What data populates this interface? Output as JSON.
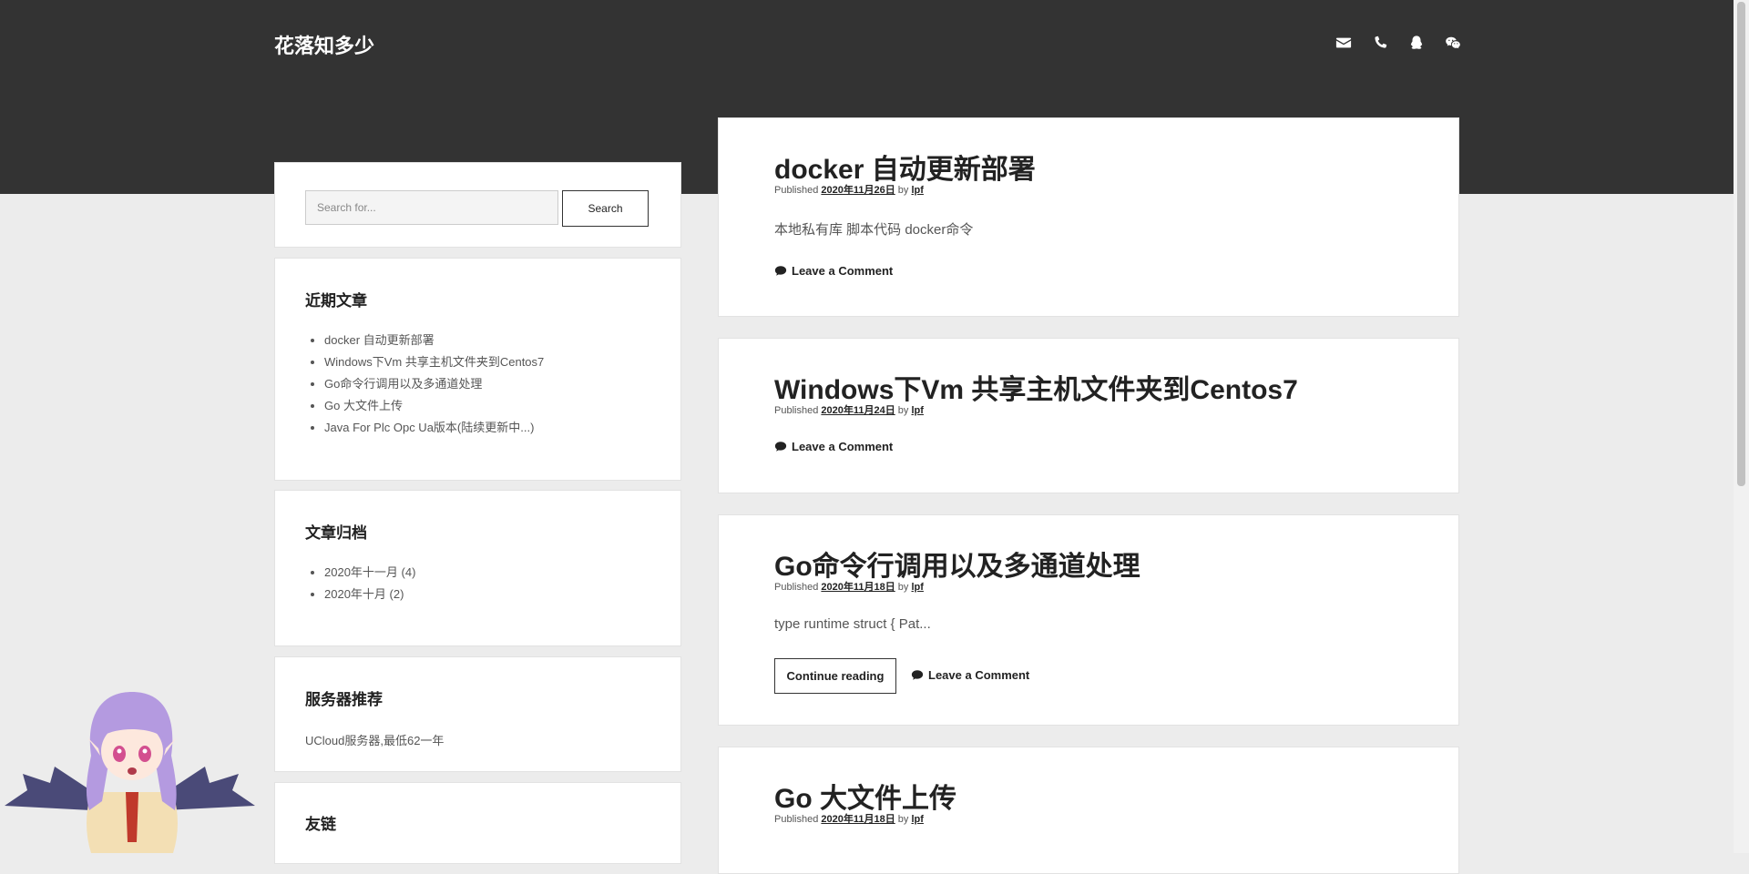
{
  "site": {
    "title": "花落知多少"
  },
  "social": [
    {
      "name": "email",
      "icon": "envelope-icon"
    },
    {
      "name": "phone",
      "icon": "phone-icon"
    },
    {
      "name": "qq",
      "icon": "qq-icon"
    },
    {
      "name": "wechat",
      "icon": "wechat-icon"
    }
  ],
  "search": {
    "placeholder": "Search for...",
    "button_label": "Search"
  },
  "sidebar": {
    "recent": {
      "title": "近期文章",
      "items": [
        "docker 自动更新部署",
        "Windows下Vm 共享主机文件夹到Centos7",
        "Go命令行调用以及多通道处理",
        "Go 大文件上传",
        "Java For Plc Opc Ua版本(陆续更新中...)"
      ]
    },
    "archives": {
      "title": "文章归档",
      "items": [
        "2020年十一月 (4)",
        "2020年十月 (2)"
      ]
    },
    "servers": {
      "title": "服务器推荐",
      "text": "UCloud服务器,最低62一年"
    },
    "links": {
      "title": "友链"
    }
  },
  "posts": [
    {
      "title": "docker 自动更新部署",
      "published_label": "Published",
      "date": "2020年11月26日",
      "by_label": "by",
      "author": "lpf",
      "excerpt": "本地私有库 脚本代码 docker命令",
      "comment_label": "Leave a Comment"
    },
    {
      "title": "Windows下Vm 共享主机文件夹到Centos7",
      "published_label": "Published",
      "date": "2020年11月24日",
      "by_label": "by",
      "author": "lpf",
      "comment_label": "Leave a Comment"
    },
    {
      "title": "Go命令行调用以及多通道处理",
      "published_label": "Published",
      "date": "2020年11月18日",
      "by_label": "by",
      "author": "lpf",
      "excerpt": "type runtime struct { Pat...",
      "continue_label": "Continue reading",
      "comment_label": "Leave a Comment"
    },
    {
      "title": "Go 大文件上传",
      "published_label": "Published",
      "date": "2020年11月18日",
      "by_label": "by",
      "author": "lpf"
    }
  ],
  "colors": {
    "header": "#333333",
    "background": "#ececec",
    "card": "#ffffff",
    "text": "#222222",
    "muted": "#555555"
  }
}
